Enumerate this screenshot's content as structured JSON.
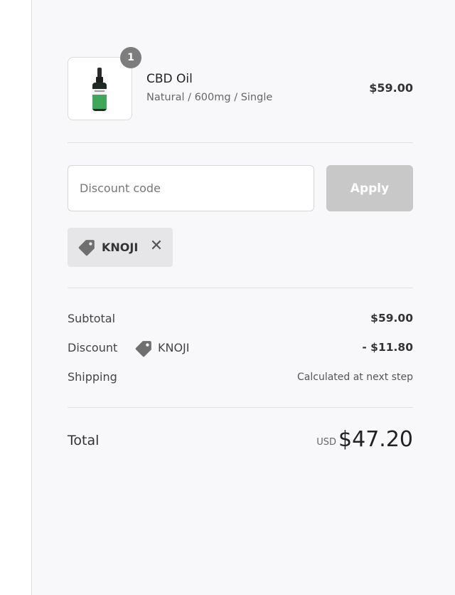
{
  "product": {
    "quantity": "1",
    "name": "CBD Oil",
    "variant": "Natural / 600mg / Single",
    "price": "$59.00",
    "image_icon": "dropper-bottle-icon"
  },
  "discount_form": {
    "placeholder": "Discount code",
    "value": "",
    "apply_label": "Apply"
  },
  "applied_code": {
    "code": "KNOJI",
    "icon": "tag-icon",
    "remove_icon": "close-icon"
  },
  "totals": {
    "subtotal_label": "Subtotal",
    "subtotal_value": "$59.00",
    "discount_label": "Discount",
    "discount_code": "KNOJI",
    "discount_value": "- $11.80",
    "shipping_label": "Shipping",
    "shipping_value": "Calculated at next step",
    "total_label": "Total",
    "currency": "USD",
    "total_value": "$47.20"
  },
  "colors": {
    "panel_background": "#f8f8fa",
    "badge": "#7d7d7d",
    "apply_button_disabled": "#c8c8c8",
    "tag_background": "#e6e6e8",
    "bottle_label_green": "#3fa65a"
  }
}
